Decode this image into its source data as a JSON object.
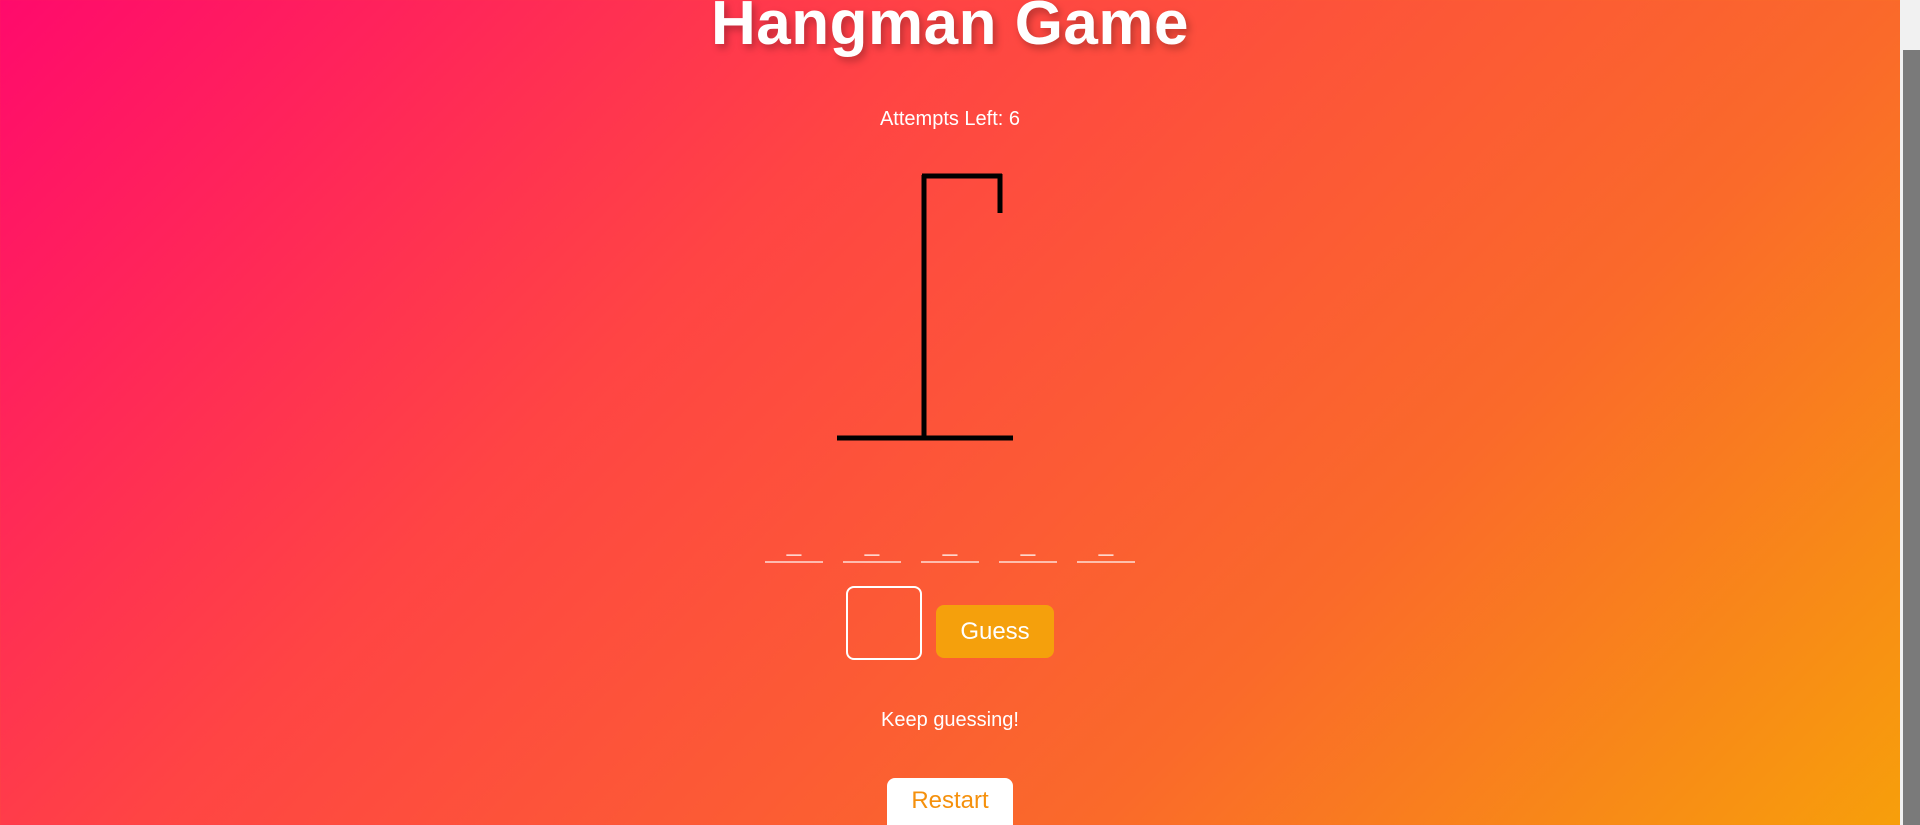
{
  "title": "Hangman Game",
  "attempts": {
    "label": "Attempts Left: 6",
    "value": 6
  },
  "word": {
    "slots": [
      "_",
      "_",
      "_",
      "_",
      "_"
    ]
  },
  "guess_input": {
    "value": "",
    "placeholder": ""
  },
  "guess_button": "Guess",
  "message": "Keep guessing!",
  "restart_button": "Restart",
  "gallows": {
    "stage": 0,
    "color": "#000000"
  },
  "colors": {
    "gradient_start": "#ff0a6c",
    "gradient_end": "#f7a00a",
    "accent": "#f5a00c",
    "text": "#ffffff"
  }
}
